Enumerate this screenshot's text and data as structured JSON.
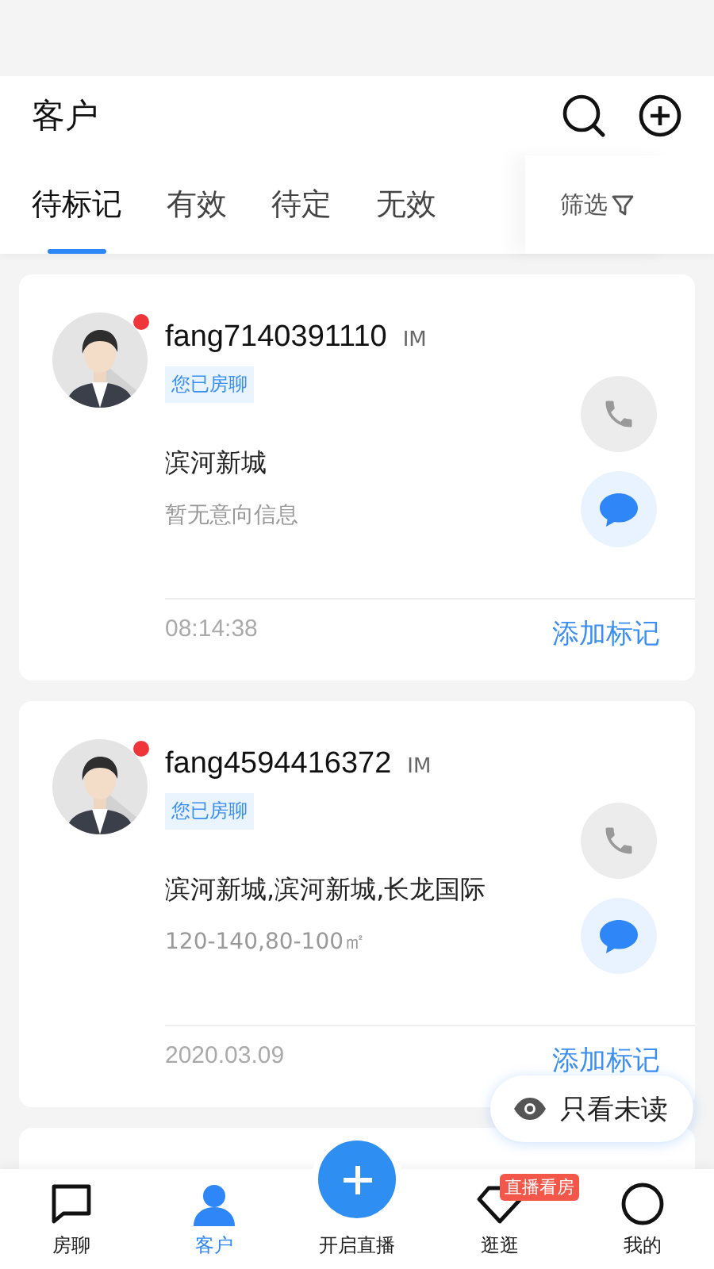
{
  "header": {
    "title": "客户"
  },
  "tabs": [
    {
      "label": "待标记",
      "selected": true
    },
    {
      "label": "有效",
      "selected": false
    },
    {
      "label": "待定",
      "selected": false
    },
    {
      "label": "无效",
      "selected": false
    }
  ],
  "filter": {
    "label": "筛选"
  },
  "customers": [
    {
      "name": "fang7140391110",
      "tag": "IM",
      "unread": true,
      "badge": "您已房聊",
      "community": "滨河新城",
      "intent": "暂无意向信息",
      "time": "08:14:38",
      "action": "添加标记"
    },
    {
      "name": "fang4594416372",
      "tag": "IM",
      "unread": true,
      "badge": "您已房聊",
      "community": "滨河新城,滨河新城,长龙国际",
      "intent": "120-140,80-100㎡",
      "time": "2020.03.09",
      "action": "添加标记"
    }
  ],
  "unread_filter": {
    "label": "只看未读"
  },
  "nav": [
    {
      "kind": "chat",
      "label": "房聊",
      "selected": false
    },
    {
      "kind": "person",
      "label": "客户",
      "selected": true
    },
    {
      "kind": "center",
      "label": "开启直播",
      "selected": false
    },
    {
      "kind": "diamond",
      "label": "逛逛",
      "selected": false,
      "badge": "直播看房"
    },
    {
      "kind": "circle",
      "label": "我的",
      "selected": false
    }
  ]
}
